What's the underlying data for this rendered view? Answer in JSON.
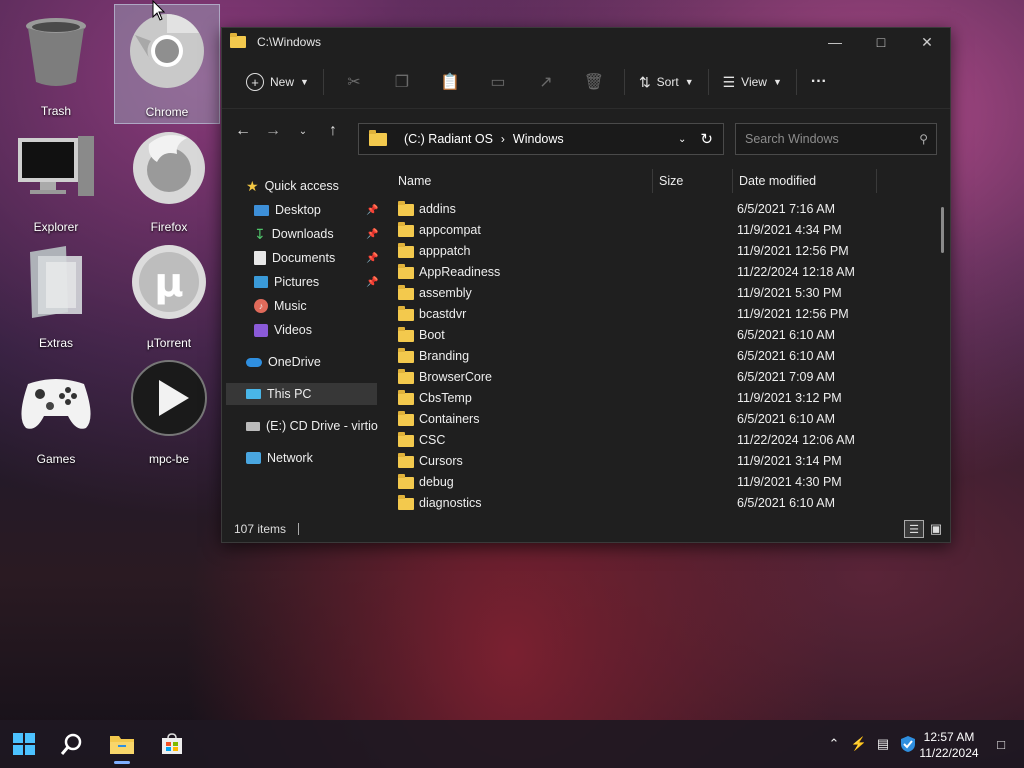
{
  "desktop": {
    "icons": [
      {
        "label": "Trash",
        "icon": "trash-icon"
      },
      {
        "label": "Chrome",
        "icon": "chrome-icon"
      },
      {
        "label": "Explorer",
        "icon": "computer-icon"
      },
      {
        "label": "Firefox",
        "icon": "firefox-icon"
      },
      {
        "label": "Extras",
        "icon": "folder-icon"
      },
      {
        "label": "µTorrent",
        "icon": "utorrent-icon"
      },
      {
        "label": "Games",
        "icon": "gamepad-icon"
      },
      {
        "label": "mpc-be",
        "icon": "media-player-icon"
      }
    ]
  },
  "window": {
    "title": "C:\\Windows",
    "toolbar": {
      "new_label": "New",
      "sort_label": "Sort",
      "view_label": "View",
      "more_label": "···"
    },
    "address": {
      "part1": "(C:) Radiant OS",
      "sep": "›",
      "part2": "Windows"
    },
    "search": {
      "placeholder": "Search Windows"
    },
    "sidebar": {
      "quick_access": "Quick access",
      "items": [
        "Desktop",
        "Downloads",
        "Documents",
        "Pictures",
        "Music",
        "Videos"
      ],
      "onedrive": "OneDrive",
      "this_pc": "This PC",
      "cd_drive": "(E:) CD Drive - virtio",
      "network": "Network"
    },
    "columns": {
      "name": "Name",
      "size": "Size",
      "date": "Date modified"
    },
    "files": [
      {
        "name": "addins",
        "date": "6/5/2021 7:16 AM"
      },
      {
        "name": "appcompat",
        "date": "11/9/2021 4:34 PM"
      },
      {
        "name": "apppatch",
        "date": "11/9/2021 12:56 PM"
      },
      {
        "name": "AppReadiness",
        "date": "11/22/2024 12:18 AM"
      },
      {
        "name": "assembly",
        "date": "11/9/2021 5:30 PM"
      },
      {
        "name": "bcastdvr",
        "date": "11/9/2021 12:56 PM"
      },
      {
        "name": "Boot",
        "date": "6/5/2021 6:10 AM"
      },
      {
        "name": "Branding",
        "date": "6/5/2021 6:10 AM"
      },
      {
        "name": "BrowserCore",
        "date": "6/5/2021 7:09 AM"
      },
      {
        "name": "CbsTemp",
        "date": "11/9/2021 3:12 PM"
      },
      {
        "name": "Containers",
        "date": "6/5/2021 6:10 AM"
      },
      {
        "name": "CSC",
        "date": "11/22/2024 12:06 AM"
      },
      {
        "name": "Cursors",
        "date": "11/9/2021 3:14 PM"
      },
      {
        "name": "debug",
        "date": "11/9/2021 4:30 PM"
      },
      {
        "name": "diagnostics",
        "date": "6/5/2021 6:10 AM"
      }
    ],
    "status": {
      "items": "107 items"
    }
  },
  "taskbar": {
    "clock_time": "12:57 AM",
    "clock_date": "11/22/2024"
  }
}
